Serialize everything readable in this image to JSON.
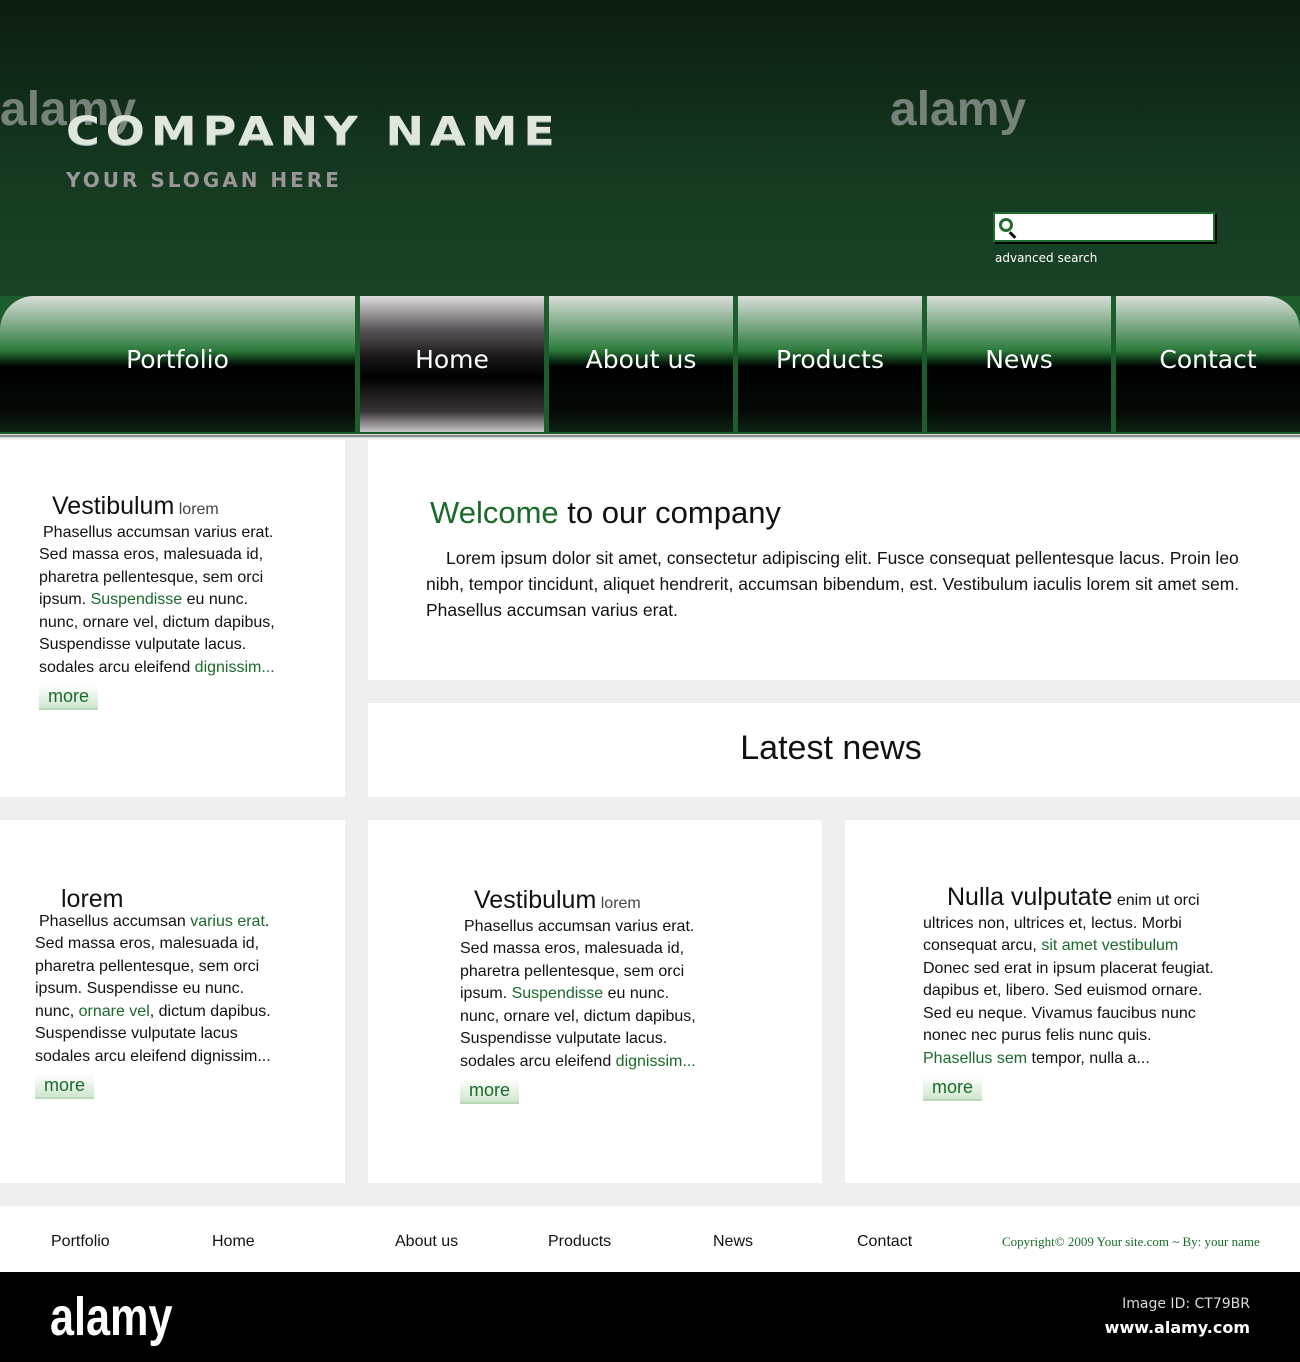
{
  "header": {
    "company": "COMPANY NAME",
    "slogan": "YOUR SLOGAN HERE",
    "search_placeholder": "",
    "advanced_search": "advanced search"
  },
  "nav": [
    "Portfolio",
    "Home",
    "About us",
    "Products",
    "News",
    "Contact"
  ],
  "left_box": {
    "title": "Vestibulum",
    "title_small": "lorem",
    "lines": [
      "Phasellus accumsan varius erat.",
      "Sed massa eros, malesuada id,",
      "pharetra pellentesque, sem orci"
    ],
    "l4a": "ipsum.",
    "l4g": "Suspendisse",
    "l4b": "eu nunc.",
    "l5": "nunc, ornare vel, dictum dapibus,",
    "l6": "Suspendisse vulputate lacus.",
    "l7a": "sodales arcu eleifend",
    "l7g": "dignissim...",
    "more": "more"
  },
  "welcome": {
    "title_green": "Welcome",
    "title_rest": "to our company",
    "body": "Lorem ipsum dolor sit amet, consectetur adipiscing elit. Fusce  consequat pellentesque lacus. Proin leo nibh, tempor tincidunt,  aliquet hendrerit, accumsan bibendum, est. Vestibulum iaculis lorem sit amet sem. Phasellus accumsan varius erat."
  },
  "latest_news": "Latest news",
  "box1": {
    "title": "lorem",
    "l1a": "Phasellus accumsan",
    "l1g": "varius erat",
    "l1b": ".",
    "l2": "Sed massa eros, malesuada id,",
    "l3": "pharetra pellentesque, sem orci",
    "l4": "ipsum. Suspendisse eu nunc.",
    "l5a": "nunc,",
    "l5g": "ornare vel",
    "l5b": ", dictum dapibus.",
    "l6": "Suspendisse vulputate lacus",
    "l7": "sodales arcu eleifend dignissim...",
    "more": "more"
  },
  "box2": {
    "title": "Vestibulum",
    "title_small": "lorem",
    "l1": "Phasellus accumsan varius erat.",
    "l2": "Sed massa eros, malesuada id,",
    "l3": "pharetra pellentesque, sem orci",
    "l4a": "ipsum.",
    "l4g": "Suspendisse",
    "l4b": "eu nunc.",
    "l5": "nunc, ornare vel, dictum dapibus,",
    "l6": "Suspendisse vulputate lacus.",
    "l7a": "sodales arcu eleifend",
    "l7g": "dignissim...",
    "more": "more"
  },
  "box3": {
    "title": "Nulla vulputate",
    "title_small": "enim ut orci",
    "l1": "ultrices non, ultrices et, lectus. Morbi",
    "l2a": "consequat arcu,",
    "l2g": "sit amet vestibulum",
    "l3": "Donec sed erat in ipsum placerat feugiat.",
    "l4": "dapibus et, libero. Sed euismod ornare.",
    "l5": "Sed eu neque. Vivamus faucibus nunc",
    "l6": "nonec nec purus  felis nunc quis.",
    "l7g": "Phasellus sem",
    "l7b": "tempor, nulla a...",
    "more": "more"
  },
  "footer": {
    "links": [
      "Portfolio",
      "Home",
      "About us",
      "Products",
      "News",
      "Contact"
    ],
    "copyright": "Copyright© 2009 Your site.com ~  By: your name"
  },
  "watermark": {
    "logo": "alamy",
    "image_id": "Image ID: CT79BR",
    "url": "www.alamy.com"
  }
}
